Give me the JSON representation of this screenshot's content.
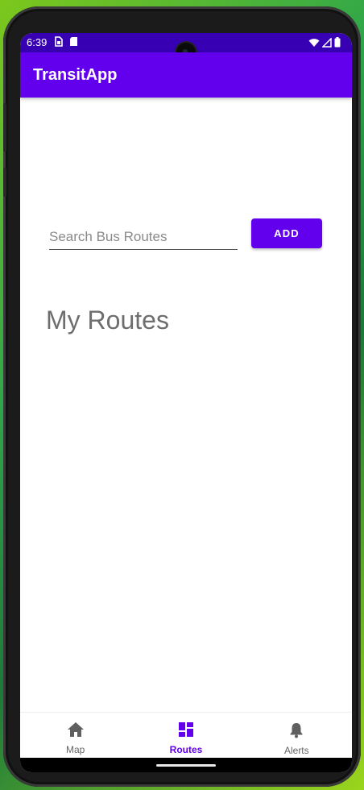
{
  "status_bar": {
    "time": "6:39",
    "left_icons": [
      "sim-card-icon",
      "sd-card-icon"
    ],
    "right_icons": [
      "wifi-icon",
      "signal-icon",
      "battery-icon"
    ],
    "color": "#3700b3"
  },
  "app_bar": {
    "title": "TransitApp",
    "color": "#6200ee"
  },
  "search": {
    "placeholder": "Search Bus Routes",
    "value": ""
  },
  "add_button": {
    "label": "ADD"
  },
  "section": {
    "title": "My Routes"
  },
  "bottom_nav": {
    "items": [
      {
        "label": "Map",
        "icon": "home-icon",
        "active": false
      },
      {
        "label": "Routes",
        "icon": "dashboard-icon",
        "active": true
      },
      {
        "label": "Alerts",
        "icon": "bell-icon",
        "active": false
      }
    ],
    "active_color": "#6200ee",
    "inactive_color": "#666666"
  }
}
